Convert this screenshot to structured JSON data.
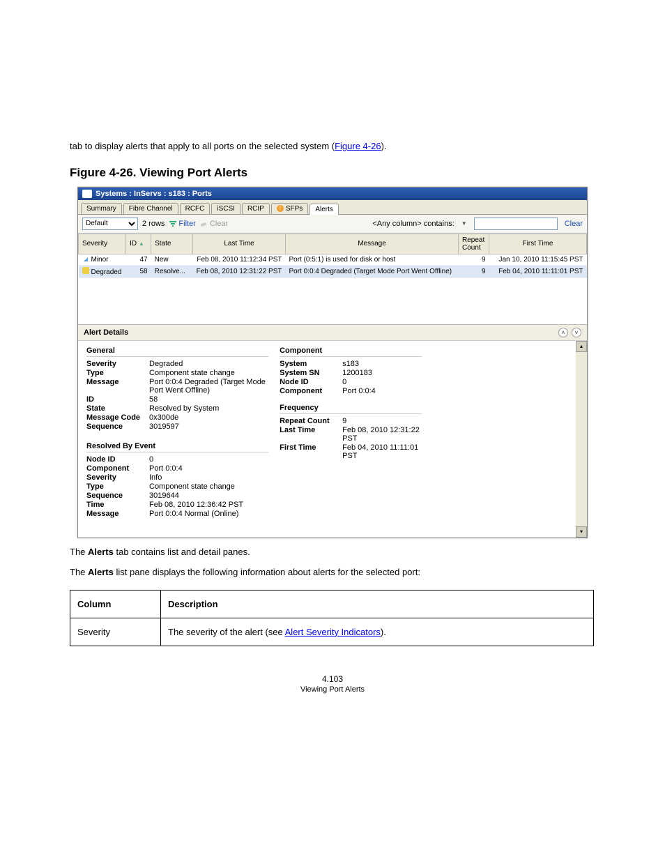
{
  "intro": {
    "paragraph": "tab to display alerts that apply to all ports on the selected system (",
    "figure_link_text": "Figure 4-26",
    "paragraph_end": ")."
  },
  "figcaption": "Figure 4-26.  Viewing Port Alerts",
  "app": {
    "title": "Systems : InServs : s183 : Ports",
    "tabs": [
      "Summary",
      "Fibre Channel",
      "RCFC",
      "iSCSI",
      "RCIP",
      "SFPs",
      "Alerts"
    ],
    "sfp_warn": true,
    "active_tab": "Alerts",
    "default_view": "Default",
    "row_count": "2 rows",
    "filter_label": "Filter",
    "clear_label": "Clear",
    "searchlabel": "<Any column> contains:",
    "clear_link": "Clear",
    "columns": [
      "Severity",
      "ID",
      "State",
      "Last Time",
      "Message",
      "Repeat Count",
      "First Time"
    ],
    "sort_col": "ID",
    "rows": [
      {
        "sev": "Minor",
        "sev_type": "minor",
        "id": "47",
        "state": "New",
        "last": "Feb 08, 2010 11:12:34 PST",
        "msg": "Port (0:5:1) is used for disk or host",
        "repeat": "9",
        "first": "Jan 10, 2010 11:15:45 PST",
        "selected": false
      },
      {
        "sev": "Degraded",
        "sev_type": "deg",
        "id": "58",
        "state": "Resolve...",
        "last": "Feb 08, 2010 12:31:22 PST",
        "msg": "Port 0:0:4 Degraded (Target Mode Port Went Offline)",
        "repeat": "9",
        "first": "Feb 04, 2010 11:11:01 PST",
        "selected": true
      }
    ],
    "details_title": "Alert Details",
    "general_head": "General",
    "general": {
      "Severity": "Degraded",
      "Type": "Component state change",
      "Message": "Port 0:0:4 Degraded (Target Mode Port Went Offline)",
      "ID": "58",
      "State": "Resolved by System",
      "Message Code": "0x300de",
      "Sequence": "3019597"
    },
    "resolved_head": "Resolved By Event",
    "resolved": {
      "Node ID": "0",
      "Component": "Port 0:0:4",
      "Severity": "Info",
      "Type": "Component state change",
      "Sequence": "3019644",
      "Time": "Feb 08, 2010 12:36:42 PST",
      "Message": "Port 0:0:4 Normal (Online)"
    },
    "component_head": "Component",
    "component": {
      "System": "s183",
      "System SN": "1200183",
      "Node ID": "0",
      "Component": "Port 0:0:4"
    },
    "frequency_head": "Frequency",
    "frequency": {
      "Repeat Count": "9",
      "Last Time": "Feb 08, 2010 12:31:22 PST",
      "First Time": "Feb 04, 2010 11:11:01 PST"
    }
  },
  "after_text_1": "The ",
  "after_text_1b": "Alerts",
  "after_text_1c": " tab contains list and detail panes.",
  "after_text_2a": "The ",
  "after_text_2b": "Alerts",
  "after_text_2c": " list pane displays the following information about alerts for the selected port:",
  "doc_table": {
    "header_col": "Column",
    "header_desc": "Description",
    "row_col": "Severity",
    "row_desc_a": "The severity of the alert (see ",
    "row_desc_link": "Alert Severity Indicators",
    "row_desc_b": ")."
  },
  "page_number": "4.103",
  "page_label": "Viewing Port Alerts"
}
